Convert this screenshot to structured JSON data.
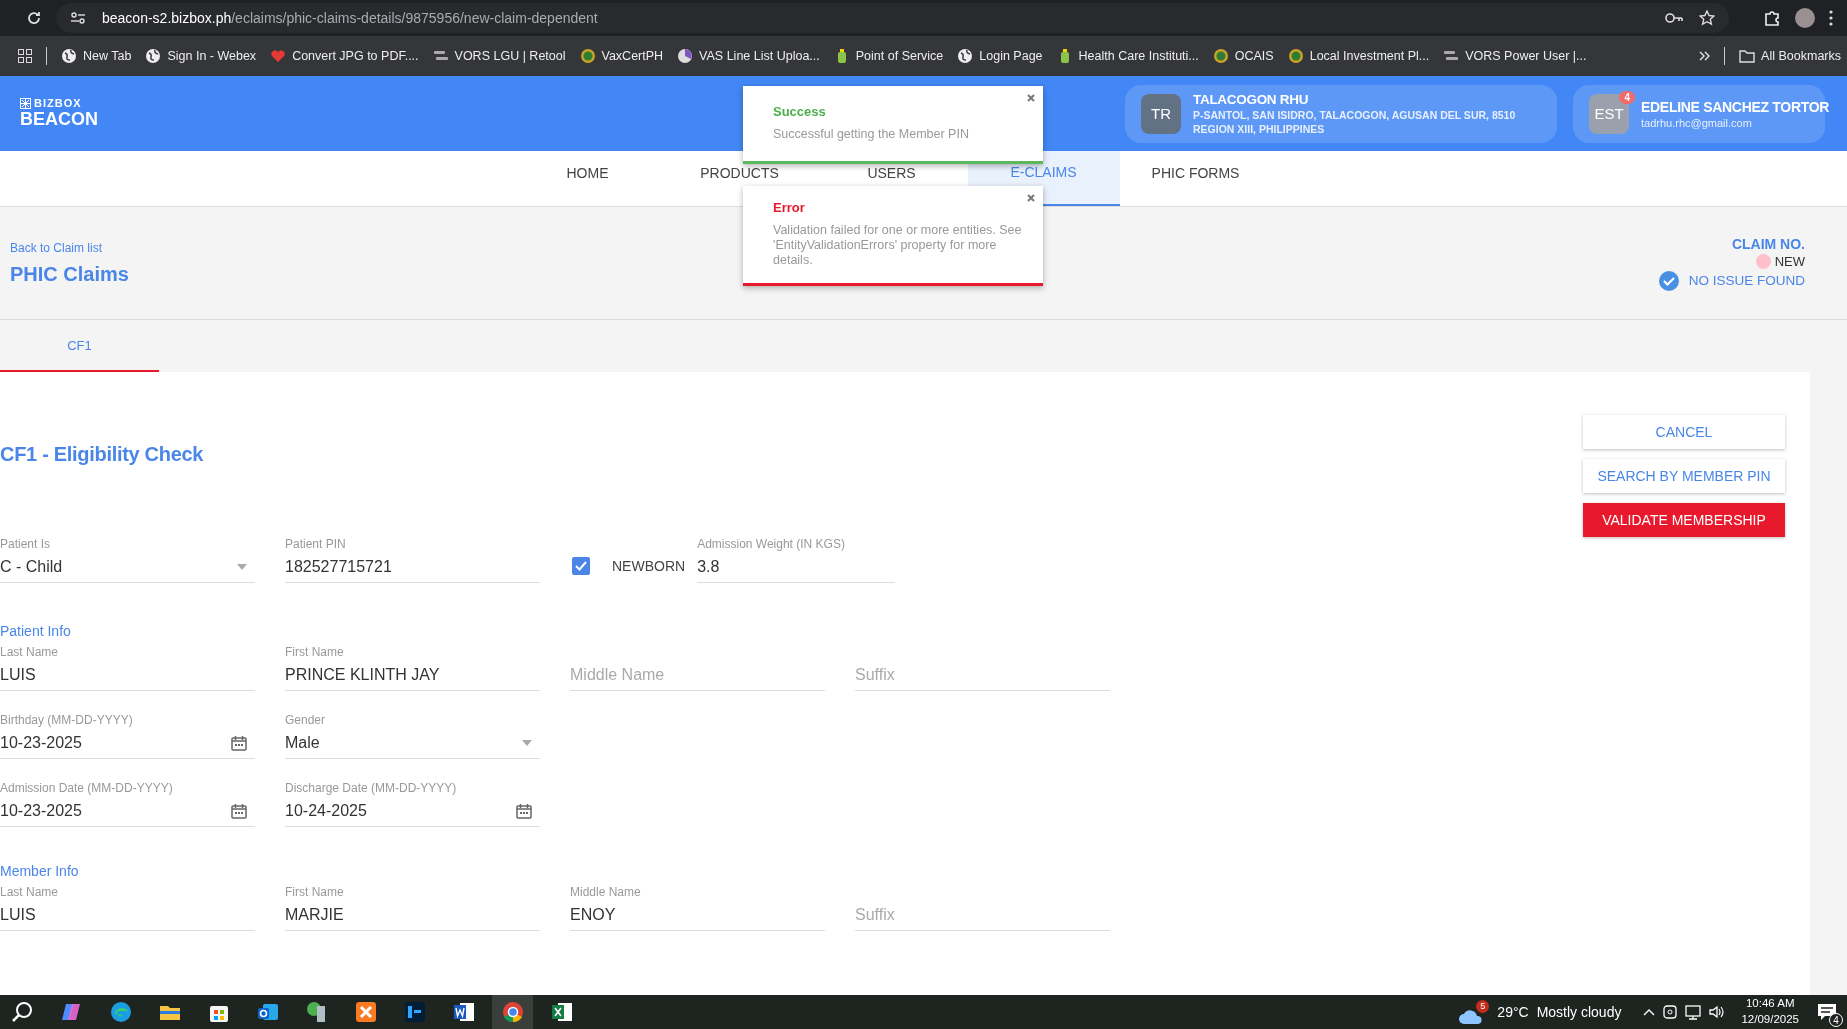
{
  "browser": {
    "url_host": "beacon-s2.bizbox.ph",
    "url_path": "/eclaims/phic-claims-details/9875956/new-claim-dependent",
    "bookmarks": [
      {
        "label": "New Tab",
        "kind": "globe"
      },
      {
        "label": "Sign In - Webex",
        "kind": "globe"
      },
      {
        "label": "Convert JPG to PDF....",
        "kind": "heart"
      },
      {
        "label": "VORS LGU | Retool",
        "kind": "bars"
      },
      {
        "label": "VaxCertPH",
        "kind": "seal"
      },
      {
        "label": "VAS Line List Uploa...",
        "kind": "pie"
      },
      {
        "label": "Point of Service",
        "kind": "bottle"
      },
      {
        "label": "Login Page",
        "kind": "globe"
      },
      {
        "label": "Health Care Instituti...",
        "kind": "bottle"
      },
      {
        "label": "OCAIS",
        "kind": "seal"
      },
      {
        "label": "Local Investment Pl...",
        "kind": "seal"
      },
      {
        "label": "VORS Power User |...",
        "kind": "bars"
      }
    ],
    "all_bookmarks": "All Bookmarks"
  },
  "header": {
    "brand_top": "BIZBOX",
    "brand": "BEACON",
    "facility": {
      "initials": "TR",
      "name": "TALACOGON RHU",
      "address_1": "P-SANTOL, SAN ISIDRO, TALACOGON, AGUSAN DEL SUR, 8510",
      "address_2": "REGION XIII, PHILIPPINES"
    },
    "user": {
      "initials": "EST",
      "badge": "4",
      "name": "EDELINE SANCHEZ TORTOR",
      "email": "tadrhu.rhc@gmail.com"
    }
  },
  "nav": [
    {
      "label": "HOME",
      "selected": false
    },
    {
      "label": "PRODUCTS",
      "selected": false
    },
    {
      "label": "USERS",
      "selected": false
    },
    {
      "label": "E-CLAIMS",
      "selected": true
    },
    {
      "label": "PHIC FORMS",
      "selected": false
    }
  ],
  "toasts": [
    {
      "kind": "success",
      "title": "Success",
      "message": "Successful getting the Member PIN"
    },
    {
      "kind": "error",
      "title": "Error",
      "message": "Validation failed for one or more entities. See 'EntityValidationErrors' property for more details."
    }
  ],
  "claim_header": {
    "back_link": "Back to Claim list",
    "title": "PHIC Claims",
    "claim_no_label": "CLAIM NO.",
    "status": "NEW",
    "issue": "NO ISSUE FOUND"
  },
  "form_tabs": [
    {
      "label": "CF1",
      "selected": true
    }
  ],
  "form": {
    "title": "CF1 - Eligibility Check",
    "buttons": [
      {
        "label": "CANCEL",
        "kind": "outline"
      },
      {
        "label": "SEARCH BY MEMBER PIN",
        "kind": "outline"
      },
      {
        "label": "VALIDATE MEMBERSHIP",
        "kind": "primary"
      }
    ],
    "eligibility": {
      "patient_is": {
        "label": "Patient Is",
        "value": "C - Child"
      },
      "patient_pin": {
        "label": "Patient PIN",
        "value": "182527715721"
      },
      "newborn": {
        "label": "NEWBORN",
        "checked": true
      },
      "admission_weight": {
        "label": "Admission Weight (IN KGS)",
        "value": "3.8"
      }
    },
    "sections": [
      {
        "heading": "Patient Info",
        "rows": [
          [
            {
              "kind": "text",
              "label": "Last Name",
              "value": "LUIS"
            },
            {
              "kind": "text",
              "label": "First Name",
              "value": "PRINCE KLINTH JAY"
            },
            {
              "kind": "text",
              "placeholder": "Middle Name"
            },
            {
              "kind": "text",
              "placeholder": "Suffix"
            }
          ],
          [
            {
              "kind": "date",
              "label": "Birthday (MM-DD-YYYY)",
              "value": "10-23-2025"
            },
            {
              "kind": "select",
              "label": "Gender",
              "value": "Male"
            }
          ],
          [
            {
              "kind": "date",
              "label": "Admission Date (MM-DD-YYYY)",
              "value": "10-23-2025"
            },
            {
              "kind": "date",
              "label": "Discharge Date (MM-DD-YYYY)",
              "value": "10-24-2025"
            }
          ]
        ]
      },
      {
        "heading": "Member Info",
        "rows": [
          [
            {
              "kind": "text",
              "label": "Last Name",
              "value": "LUIS"
            },
            {
              "kind": "text",
              "label": "First Name",
              "value": "MARJIE"
            },
            {
              "kind": "text",
              "label": "Middle Name",
              "value": "ENOY"
            },
            {
              "kind": "text",
              "placeholder": "Suffix"
            }
          ]
        ]
      }
    ]
  },
  "taskbar": {
    "apps": [
      {
        "kind": "search",
        "selected": false
      },
      {
        "kind": "copilot",
        "selected": false
      },
      {
        "kind": "edge",
        "selected": false
      },
      {
        "kind": "files",
        "selected": false
      },
      {
        "kind": "store",
        "selected": false
      },
      {
        "kind": "mail",
        "selected": false
      },
      {
        "kind": "server",
        "selected": false
      },
      {
        "kind": "xampp",
        "selected": false
      },
      {
        "kind": "ps",
        "selected": false
      },
      {
        "kind": "word",
        "selected": false
      },
      {
        "kind": "chrome",
        "selected": true
      },
      {
        "kind": "excel",
        "selected": false
      }
    ],
    "weather": {
      "badge": "5",
      "temp": "29°C",
      "condition": "Mostly cloudy"
    },
    "time": "10:46 AM",
    "date": "12/09/2025",
    "notifications": "4"
  }
}
